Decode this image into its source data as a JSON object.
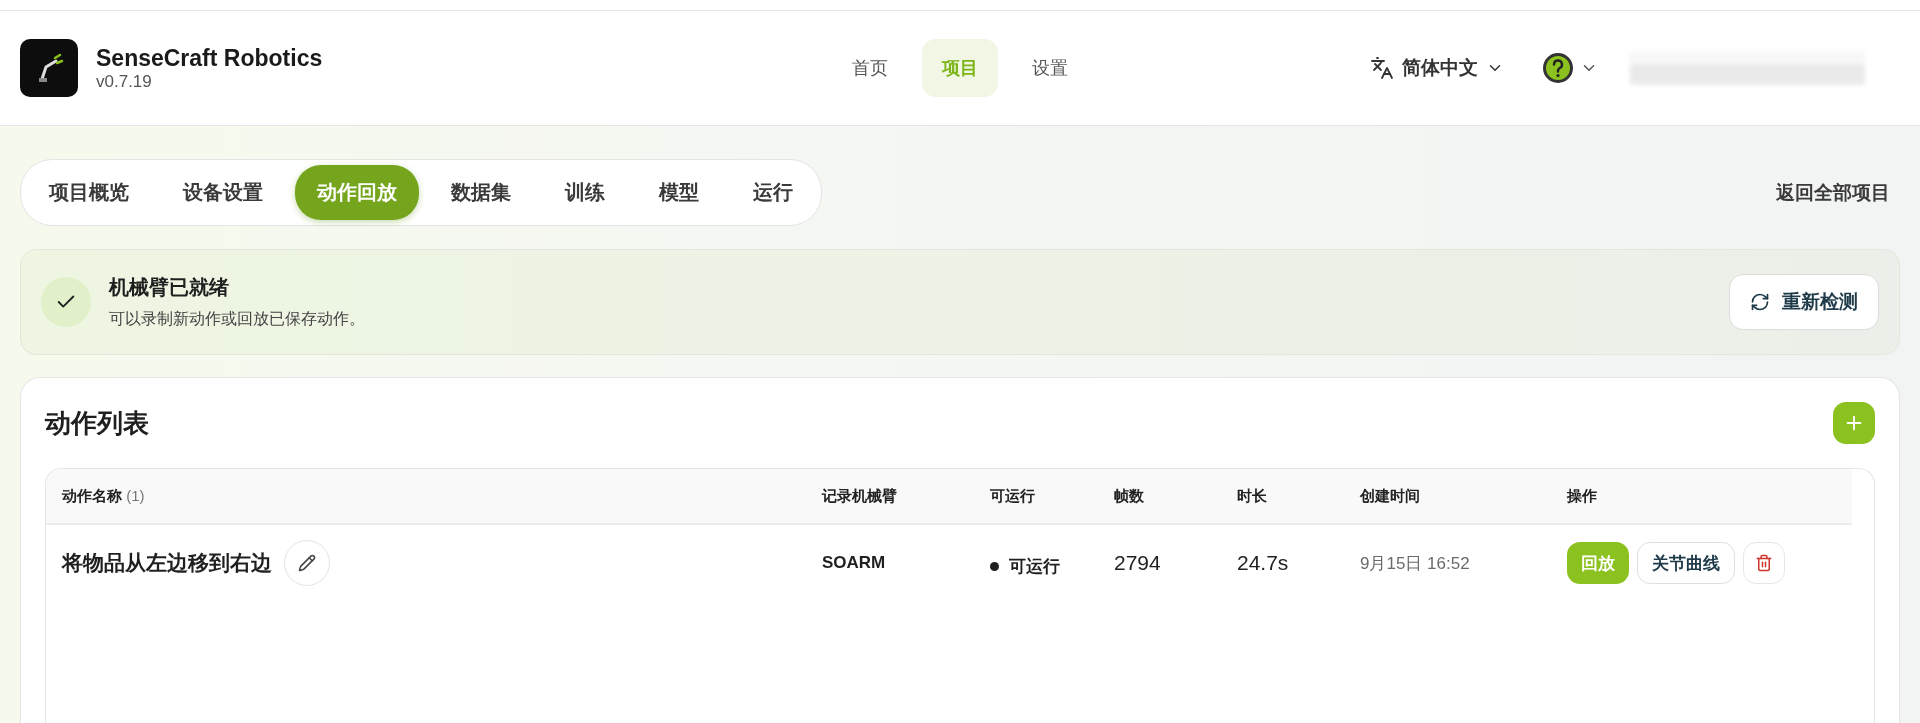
{
  "header": {
    "app_name": "SenseCraft Robotics",
    "version": "v0.7.19",
    "nav": [
      {
        "label": "首页",
        "selected": false
      },
      {
        "label": "项目",
        "selected": true
      },
      {
        "label": "设置",
        "selected": false
      }
    ],
    "language": "简体中文"
  },
  "tabs": [
    {
      "label": "项目概览",
      "selected": false
    },
    {
      "label": "设备设置",
      "selected": false
    },
    {
      "label": "动作回放",
      "selected": true
    },
    {
      "label": "数据集",
      "selected": false
    },
    {
      "label": "训练",
      "selected": false
    },
    {
      "label": "模型",
      "selected": false
    },
    {
      "label": "运行",
      "selected": false
    }
  ],
  "back_link": "返回全部项目",
  "status": {
    "title": "机械臂已就绪",
    "message": "可以录制新动作或回放已保存动作。",
    "button": "重新检测"
  },
  "action_list": {
    "title": "动作列表",
    "columns": [
      {
        "label": "动作名称",
        "count": "(1)"
      },
      {
        "label": "记录机械臂"
      },
      {
        "label": "可运行"
      },
      {
        "label": "帧数"
      },
      {
        "label": "时长"
      },
      {
        "label": "创建时间"
      },
      {
        "label": "操作"
      }
    ],
    "rows": [
      {
        "name": "将物品从左边移到右边",
        "arm": "SOARM",
        "runnable": true,
        "runnable_label": "可运行",
        "frames": "2794",
        "duration": "24.7s",
        "created": "9月15日 16:52",
        "play": "回放",
        "curves": "关节曲线"
      }
    ]
  }
}
